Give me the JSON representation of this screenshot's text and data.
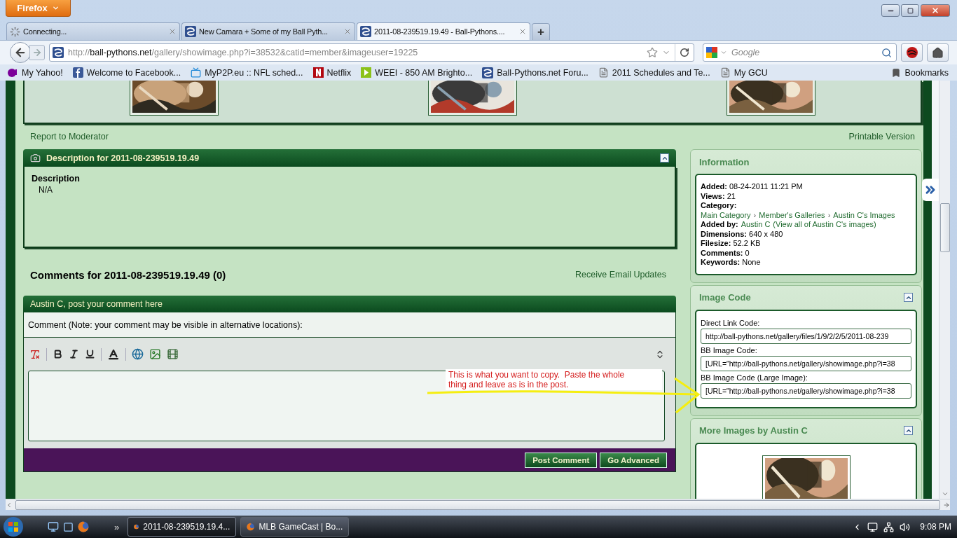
{
  "browser": {
    "menu_button": "Firefox",
    "tabs": [
      {
        "title": "Connecting...",
        "kind": "loading",
        "selected": false
      },
      {
        "title": "New Camara + Some of my Ball Pyth...",
        "kind": "site",
        "selected": false
      },
      {
        "title": "2011-08-239519.19.49 - Ball-Pythons....",
        "kind": "site",
        "selected": true
      }
    ],
    "new_tab": "+",
    "address": {
      "scheme": "http://",
      "host": "ball-pythons.net",
      "path": "/gallery/showimage.php?i=38532&catid=member&imageuser=19225"
    },
    "search": {
      "placeholder": "Google"
    },
    "bookmarks": [
      {
        "label": "My Yahoo!",
        "kind": "yahoo"
      },
      {
        "label": "Welcome to Facebook...",
        "kind": "facebook"
      },
      {
        "label": "MyP2P.eu :: NFL sched...",
        "kind": "tv"
      },
      {
        "label": "Netflix",
        "kind": "netflix"
      },
      {
        "label": "WEEI - 850 AM Brighto...",
        "kind": "media"
      },
      {
        "label": "Ball-Pythons.net Foru...",
        "kind": "site"
      },
      {
        "label": "2011 Schedules and Te...",
        "kind": "page"
      },
      {
        "label": "My GCU",
        "kind": "page"
      }
    ],
    "bookmarks_menu": "Bookmarks"
  },
  "page": {
    "report_link": "Report to Moderator",
    "printable_link": "Printable Version",
    "description_panel": {
      "title": "Description for 2011-08-239519.19.49",
      "expanded": true,
      "label": "Description",
      "value": "N/A"
    },
    "comments_heading": "Comments for 2011-08-239519.19.49 (0)",
    "email_link": "Receive Email Updates",
    "comment_form": {
      "title": "Austin C, post your comment here",
      "note": "Comment (Note: your comment may be visible in alternative locations):",
      "buttons": [
        "Post Comment",
        "Go Advanced"
      ]
    },
    "annotation": "This is what you want to copy.  Paste the whole thing and leave as is in the post.",
    "information": {
      "title": "Information",
      "rows": [
        {
          "kind": "field",
          "label": "Added:",
          "value": "08-24-2011 11:21 PM"
        },
        {
          "kind": "field",
          "label": "Views:",
          "value": "21"
        },
        {
          "kind": "heading",
          "label": "Category:"
        },
        {
          "kind": "breadcrumb",
          "separator": "›",
          "links": [
            "Main Category",
            "Member's Galleries",
            "Austin C's Images"
          ]
        },
        {
          "kind": "links",
          "label": "Added by:",
          "links": [
            "Austin C",
            "(View all of Austin C's images)"
          ]
        },
        {
          "kind": "field",
          "label": "Dimensions:",
          "value": "640 x 480"
        },
        {
          "kind": "field",
          "label": "Filesize:",
          "value": "52.2 KB"
        },
        {
          "kind": "field",
          "label": "Comments:",
          "value": "0"
        },
        {
          "kind": "field",
          "label": "Keywords:",
          "value": "None"
        }
      ]
    },
    "image_code": {
      "title": "Image Code",
      "expanded": true,
      "fields": [
        {
          "label": "Direct Link Code:",
          "value": "http://ball-pythons.net/gallery/files/1/9/2/2/5/2011-08-239"
        },
        {
          "label": "BB Image Code:",
          "value": "[URL=\"http://ball-pythons.net/gallery/showimage.php?i=38"
        },
        {
          "label": "BB Image Code (Large Image):",
          "value": "[URL=\"http://ball-pythons.net/gallery/showimage.php?i=38"
        }
      ]
    },
    "more_images": {
      "title": "More Images by Austin C",
      "expanded": true
    }
  },
  "taskbar": {
    "overflow": "»",
    "items": [
      {
        "label": "2011-08-239519.19.4...",
        "selected": true
      },
      {
        "label": "MLB GameCast | Bo...",
        "selected": false
      }
    ],
    "clock": "9:08 PM"
  }
}
